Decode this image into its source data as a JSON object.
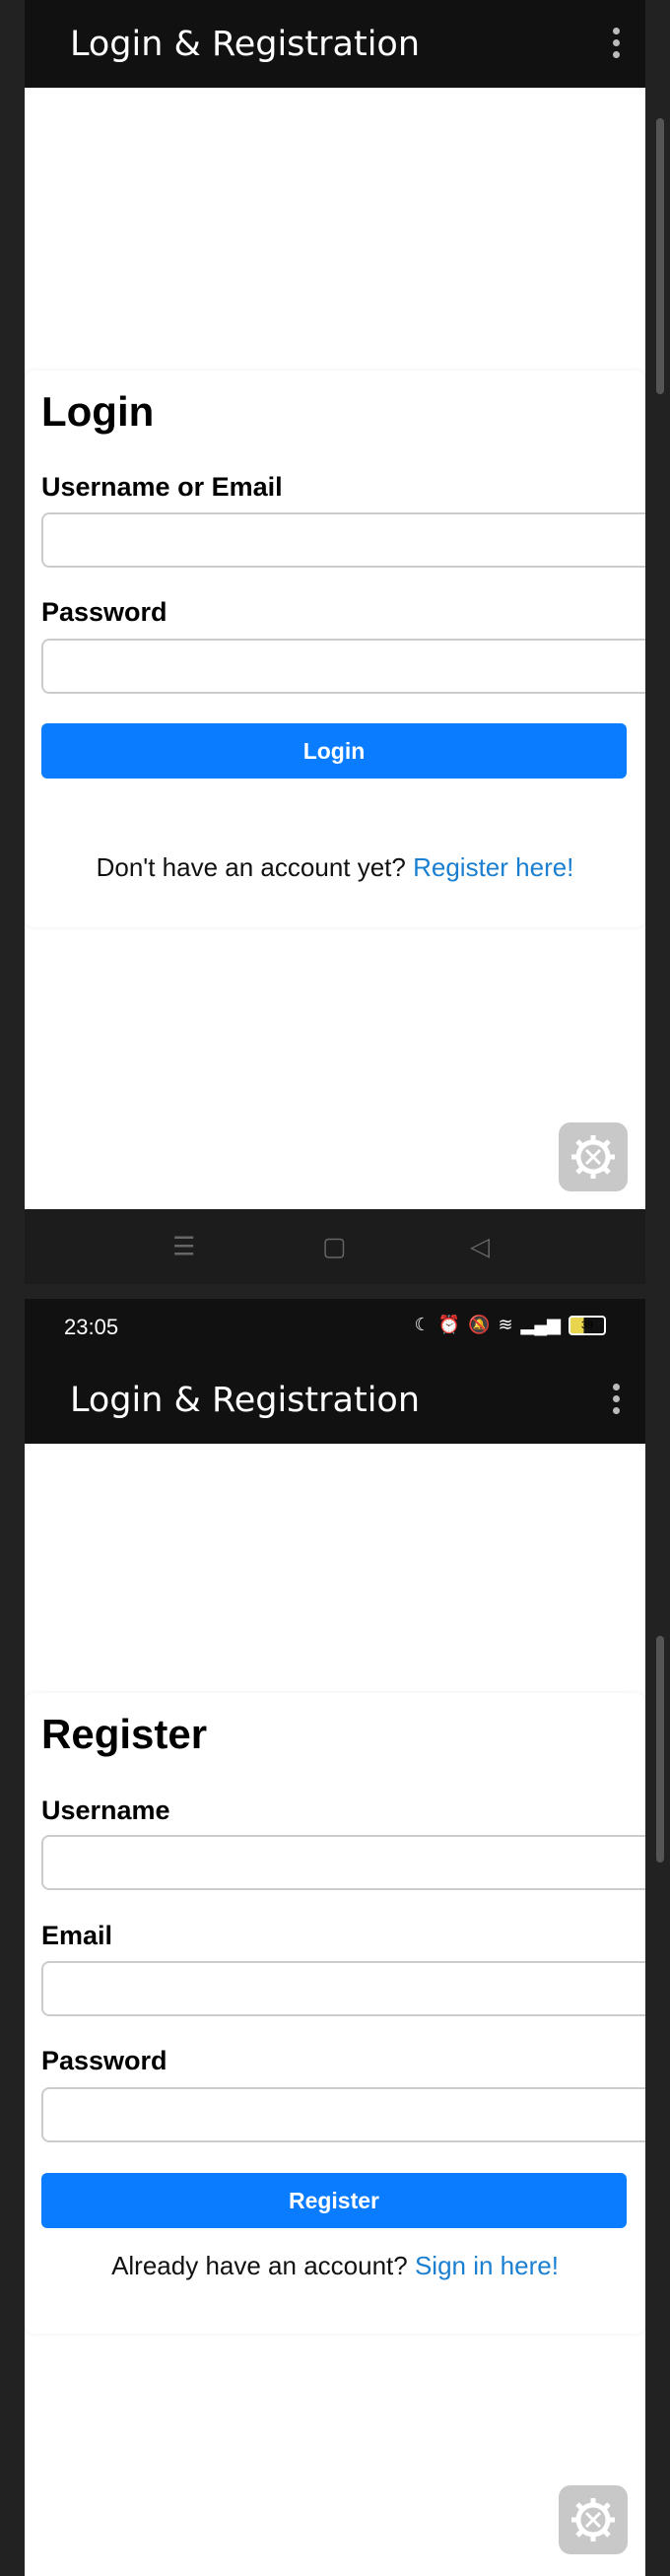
{
  "top": {
    "appbar": {
      "title": "Login & Registration"
    },
    "login": {
      "heading": "Login",
      "username_label": "Username or Email",
      "password_label": "Password",
      "button_label": "Login",
      "alt_text": "Don't have an account yet?",
      "alt_link": "Register here!"
    }
  },
  "status": {
    "time": "23:05",
    "battery": "39"
  },
  "bottom": {
    "appbar": {
      "title": "Login & Registration"
    },
    "register": {
      "heading": "Register",
      "username_label": "Username",
      "email_label": "Email",
      "password_label": "Password",
      "button_label": "Register",
      "alt_text": "Already have an account?",
      "alt_link": "Sign in here!"
    }
  },
  "nav": {
    "menu_icon": "menu-lines-icon",
    "home_icon": "square-home-icon",
    "back_icon": "triangle-back-icon"
  },
  "colors": {
    "accent": "#0a7cff",
    "link": "#1a7fd0",
    "appbar": "#111111"
  }
}
